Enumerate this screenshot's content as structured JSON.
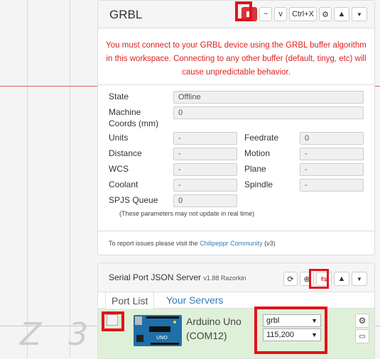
{
  "grbl": {
    "title": "GRBL",
    "buttons": {
      "stop": "stop-icon",
      "tilde": "~",
      "v": "v",
      "ctrlx": "Ctrl+X"
    },
    "warning": "You must connect to your GRBL device using the GRBL buffer algorithm in this workspace. Connecting to any other buffer (default, tinyg, etc) will cause unpredictable behavior.",
    "state_label": "State",
    "state_value": "Offline",
    "coords_label1": "Machine",
    "coords_label2": "Coords (mm)",
    "coords_value": "0",
    "fields": {
      "units_label": "Units",
      "units_value": "-",
      "feedrate_label": "Feedrate",
      "feedrate_value": "0",
      "distance_label": "Distance",
      "distance_value": "-",
      "motion_label": "Motion",
      "motion_value": "-",
      "wcs_label": "WCS",
      "wcs_value": "-",
      "plane_label": "Plane",
      "plane_value": "-",
      "coolant_label": "Coolant",
      "coolant_value": "-",
      "spindle_label": "Spindle",
      "spindle_value": "-",
      "spjs_label": "SPJS Queue",
      "spjs_value": "0"
    },
    "note": "(These parameters may not update in real time)",
    "report_prefix": "To report issues please visit the ",
    "report_link": "Chilipeppr Community",
    "report_suffix": " (v3)"
  },
  "spjs": {
    "title": "Serial Port JSON Server",
    "version": "v1.88 Razorkin",
    "tab_ports": "Port List",
    "tab_servers": "Your Servers",
    "device_name": "Arduino Uno",
    "device_port": "(COM12)",
    "buffer_value": "grbl",
    "baud_value": "115,200"
  },
  "background_text": "Z 3",
  "colors": {
    "accent_red": "#d9353f",
    "warning_text": "#e02020",
    "row_green": "#dff0d8",
    "link_blue": "#337ab7"
  }
}
